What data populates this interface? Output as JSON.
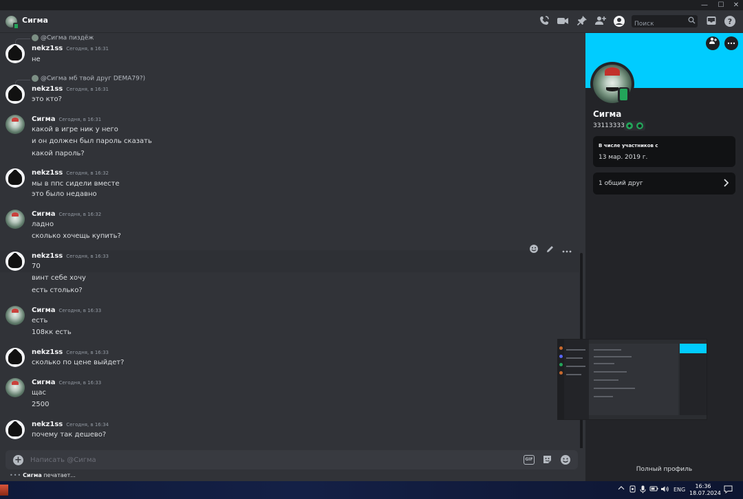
{
  "window": {
    "minimize": "—",
    "maximize": "☐",
    "close": "✕"
  },
  "header": {
    "title": "Сигма",
    "icons": [
      "phone-call-icon",
      "video-call-icon",
      "pin-icon",
      "add-friend-icon",
      "user-profile-icon",
      "inbox-icon",
      "help-icon"
    ],
    "search_placeholder": "Поиск"
  },
  "messages": [
    {
      "reply": "@Сигма пиздёж",
      "author": "nekz1ss",
      "time": "Сегодня, в 16:31",
      "avatar": "cat",
      "lines": [
        "не"
      ]
    },
    {
      "reply": "@Сигма мб твой друг DEMA79?)",
      "author": "nekz1ss",
      "time": "Сегодня, в 16:31",
      "avatar": "cat",
      "lines": [
        "это кто?"
      ]
    },
    {
      "author": "Сигма",
      "time": "Сегодня, в 16:31",
      "avatar": "clown",
      "lines": [
        "какой в игре ник у него",
        "и он должен был пароль сказать",
        "какой пароль?"
      ]
    },
    {
      "author": "nekz1ss",
      "time": "Сегодня, в 16:32",
      "avatar": "cat",
      "lines": [
        "мы в ппс сидели вместе",
        "это было недавно"
      ]
    },
    {
      "author": "Сигма",
      "time": "Сегодня, в 16:32",
      "avatar": "clown",
      "lines": [
        "ладно",
        "сколько хочещь купить?"
      ]
    },
    {
      "author": "nekz1ss",
      "time": "Сегодня, в 16:33",
      "avatar": "cat",
      "lines": [
        "70",
        "винт себе хочу",
        "есть столько?"
      ]
    },
    {
      "author": "Сигма",
      "time": "Сегодня, в 16:33",
      "avatar": "clown",
      "lines": [
        "есть",
        "108кк есть"
      ]
    },
    {
      "author": "nekz1ss",
      "time": "Сегодня, в 16:33",
      "avatar": "cat",
      "lines": [
        "сколько по цене выйдет?"
      ]
    },
    {
      "author": "Сигма",
      "time": "Сегодня, в 16:33",
      "avatar": "clown",
      "lines": [
        "щас",
        "2500"
      ]
    },
    {
      "author": "nekz1ss",
      "time": "Сегодня, в 16:34",
      "avatar": "cat",
      "lines": [
        "почему так дешево?"
      ]
    }
  ],
  "message_actions": [
    "add-reaction-icon",
    "edit-icon",
    "more-icon"
  ],
  "composer": {
    "placeholder": "Написать @Сигма",
    "gif_label": "GIF",
    "icons": [
      "attach-plus-icon",
      "gif-icon",
      "sticker-icon",
      "emoji-icon"
    ]
  },
  "typing": {
    "user": "Сигма",
    "text": "печатает..."
  },
  "profile": {
    "banner_color": "#00ccff",
    "name": "Сигма",
    "username": "33113333",
    "status": "mobile-online",
    "member_since_label": "В числе участников с",
    "member_since": "13 мар. 2019 г.",
    "mutual_friends": "1 общий друг",
    "full_profile": "Полный профиль"
  },
  "taskbar": {
    "language": "ENG",
    "time": "16:36",
    "date": "18.07.2024"
  },
  "colors": {
    "accent_online": "#23a55a",
    "background": "#313338",
    "profile_banner": "#00ccff"
  }
}
